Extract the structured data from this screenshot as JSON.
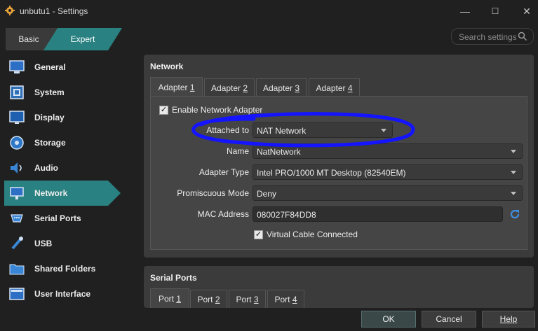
{
  "window": {
    "title": "unbutu1 - Settings",
    "controls": {
      "minimize": "—",
      "maximize": "☐",
      "close": "✕"
    }
  },
  "mode_tabs": {
    "basic": "Basic",
    "expert": "Expert"
  },
  "search": {
    "placeholder": "Search settings"
  },
  "sidebar": {
    "items": [
      {
        "label": "General",
        "icon": "general-icon"
      },
      {
        "label": "System",
        "icon": "system-icon"
      },
      {
        "label": "Display",
        "icon": "display-icon"
      },
      {
        "label": "Storage",
        "icon": "storage-icon"
      },
      {
        "label": "Audio",
        "icon": "audio-icon"
      },
      {
        "label": "Network",
        "icon": "network-icon",
        "active": true
      },
      {
        "label": "Serial Ports",
        "icon": "serial-ports-icon"
      },
      {
        "label": "USB",
        "icon": "usb-icon"
      },
      {
        "label": "Shared Folders",
        "icon": "shared-folders-icon"
      },
      {
        "label": "User Interface",
        "icon": "user-interface-icon"
      }
    ]
  },
  "network": {
    "title": "Network",
    "tabs": [
      {
        "prefix": "Adapter ",
        "mnemonic": "1"
      },
      {
        "prefix": "Adapter ",
        "mnemonic": "2"
      },
      {
        "prefix": "Adapter ",
        "mnemonic": "3"
      },
      {
        "prefix": "Adapter ",
        "mnemonic": "4"
      }
    ],
    "enable_checked": true,
    "enable_label": "Enable Network Adapter",
    "attached_to": {
      "label": "Attached to",
      "value": "NAT Network"
    },
    "name": {
      "label": "Name",
      "value": "NatNetwork"
    },
    "adapter_type": {
      "label": "Adapter Type",
      "value": "Intel PRO/1000 MT Desktop (82540EM)"
    },
    "promiscuous_mode": {
      "label": "Promiscuous Mode",
      "value": "Deny"
    },
    "mac_address": {
      "label": "MAC Address",
      "value": "080027F84DD8"
    },
    "cable_checked": true,
    "cable_label": "Virtual Cable Connected"
  },
  "serial_ports": {
    "title": "Serial Ports",
    "tabs": [
      {
        "prefix": "Port ",
        "mnemonic": "1"
      },
      {
        "prefix": "Port ",
        "mnemonic": "2"
      },
      {
        "prefix": "Port ",
        "mnemonic": "3"
      },
      {
        "prefix": "Port ",
        "mnemonic": "4"
      }
    ]
  },
  "buttons": {
    "ok": "OK",
    "cancel": "Cancel",
    "help": "Help"
  },
  "colors": {
    "accent": "#2a8181",
    "annotation": "#1414ff"
  }
}
